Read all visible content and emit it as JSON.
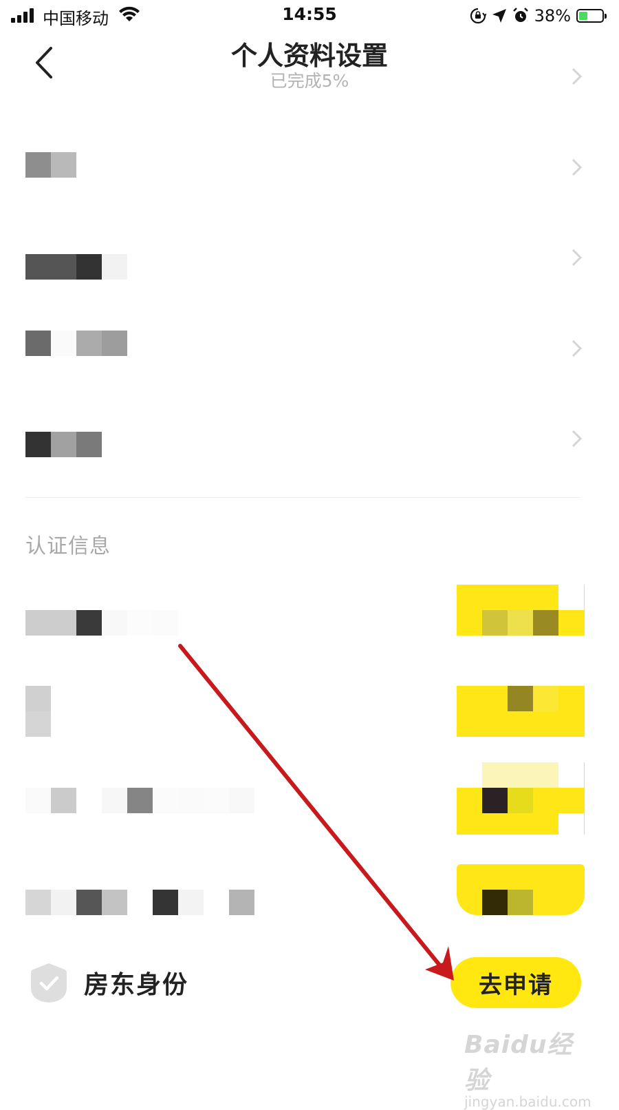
{
  "status_bar": {
    "carrier": "中国移动",
    "time": "14:55",
    "battery": "38%",
    "battery_level": 0.38
  },
  "nav": {
    "title": "个人资料设置",
    "subtitle": "已完成5%"
  },
  "section": {
    "title": "认证信息"
  },
  "landlord": {
    "label": "房东身份",
    "button_label": "去申请"
  },
  "watermark": {
    "brand": "Baidu经验",
    "url": "jingyan.baidu.com"
  },
  "colors": {
    "accent": "#ffe70f",
    "annotation_arrow": "#c8191c",
    "subtitle_gray": "#b3b3b3"
  }
}
